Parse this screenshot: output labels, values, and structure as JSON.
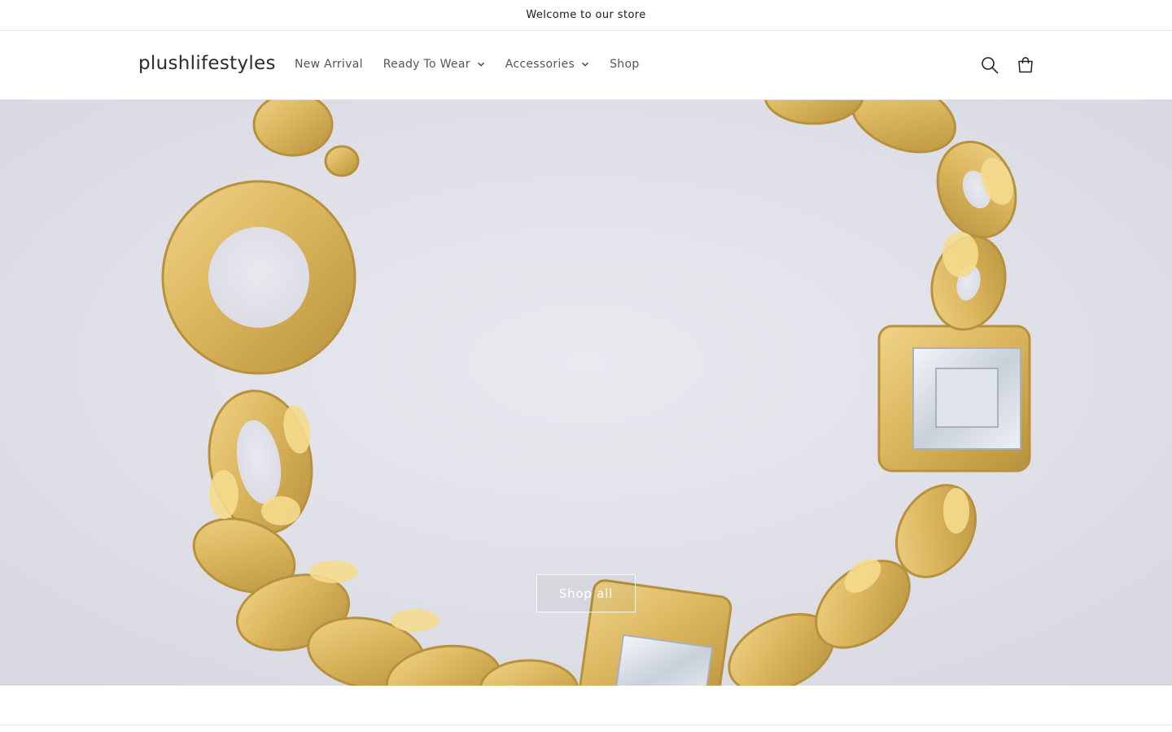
{
  "announcement": {
    "text": "Welcome to our store"
  },
  "header": {
    "logo": "plushlifestyles",
    "nav": [
      {
        "label": "New Arrival",
        "dropdown": false
      },
      {
        "label": "Ready To Wear",
        "dropdown": true
      },
      {
        "label": "Accessories",
        "dropdown": true
      },
      {
        "label": "Shop",
        "dropdown": false
      }
    ],
    "icons": {
      "search": "search-icon",
      "cart": "cart-icon",
      "chevron": "chevron-down-icon"
    }
  },
  "hero": {
    "cta_label": "Shop all",
    "image": "gold-chain-bracelet-with-crystal-stones",
    "colors": {
      "background": "#e2e2ea",
      "gold": "#d9b35a",
      "gold_highlight": "#f0d488",
      "gold_shadow": "#b8913e",
      "crystal": "#d8dde6"
    }
  }
}
